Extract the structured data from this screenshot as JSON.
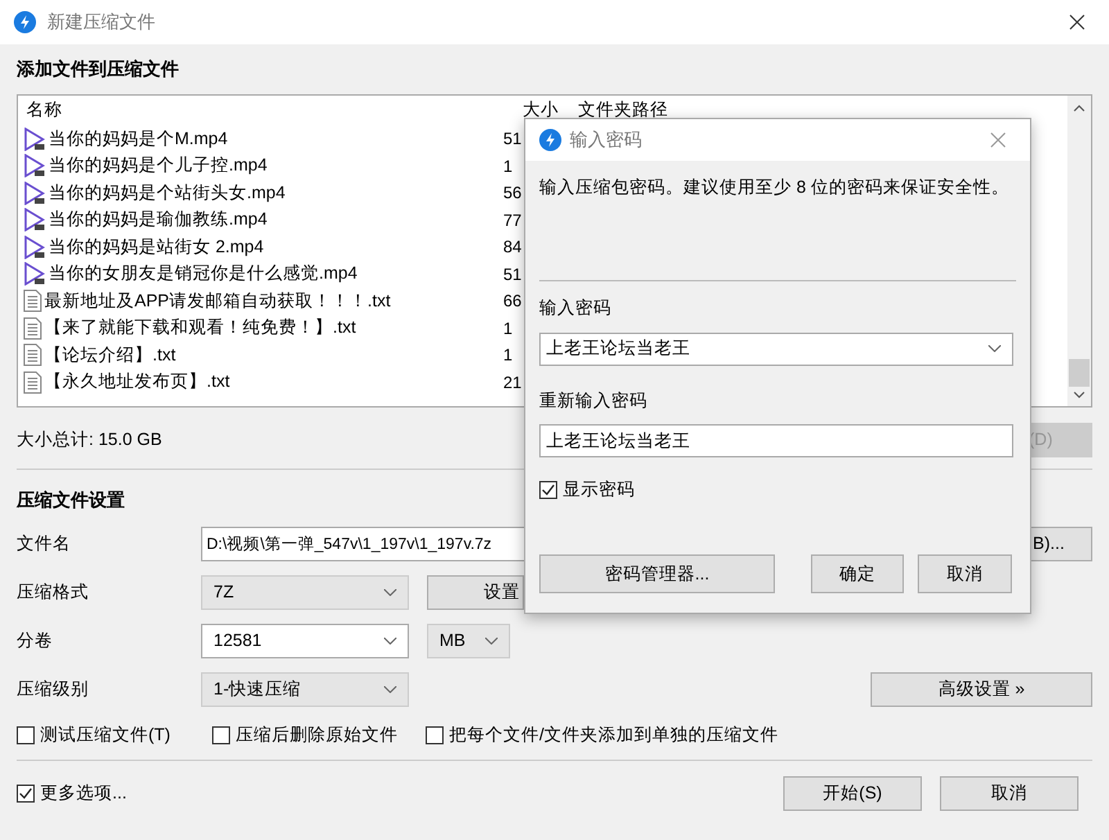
{
  "window": {
    "title": "新建压缩文件"
  },
  "add_section": {
    "title": "添加文件到压缩文件"
  },
  "file_list": {
    "columns": [
      "名称",
      "大小",
      "文件夹路径"
    ],
    "rows": [
      {
        "kind": "video",
        "name": "当你的妈妈是个M.mp4",
        "size": "51"
      },
      {
        "kind": "video",
        "name": "当你的妈妈是个儿子控.mp4",
        "size": "1"
      },
      {
        "kind": "video",
        "name": "当你的妈妈是个站街头女.mp4",
        "size": "56"
      },
      {
        "kind": "video",
        "name": "当你的妈妈是瑜伽教练.mp4",
        "size": "77"
      },
      {
        "kind": "video",
        "name": "当你的妈妈是站街女 2.mp4",
        "size": "84"
      },
      {
        "kind": "video",
        "name": "当你的女朋友是销冠你是什么感觉.mp4",
        "size": "51"
      },
      {
        "kind": "text",
        "name": "最新地址及APP请发邮箱自动获取！！！.txt",
        "size": "66"
      },
      {
        "kind": "text",
        "name": "【来了就能下载和观看！纯免费！】.txt",
        "size": "1"
      },
      {
        "kind": "text",
        "name": "【论坛介绍】.txt",
        "size": "1"
      },
      {
        "kind": "text",
        "name": "【永久地址发布页】.txt",
        "size": "21"
      }
    ]
  },
  "total": "大小总计: 15.0 GB",
  "delete_button": {
    "label": "(D)",
    "disabled": true
  },
  "settings_section": {
    "title": "压缩文件设置"
  },
  "filename": {
    "label": "文件名",
    "value": "D:\\视频\\第一弹_547v\\1_197v\\1_197v.7z",
    "browse_button": "B)..."
  },
  "format": {
    "label": "压缩格式",
    "value": "7Z",
    "settings_button": "设置"
  },
  "split": {
    "label": "分卷",
    "value": "12581",
    "unit": "MB"
  },
  "level": {
    "label": "压缩级别",
    "value": "1-快速压缩",
    "advanced_button": "高级设置 »"
  },
  "options": [
    {
      "label": "测试压缩文件(T)",
      "checked": false
    },
    {
      "label": "压缩后删除原始文件",
      "checked": false
    },
    {
      "label": "把每个文件/文件夹添加到单独的压缩文件",
      "checked": false
    }
  ],
  "more_options": {
    "label": "更多选项...",
    "checked": true
  },
  "buttons": [
    "开始(S)",
    "取消"
  ],
  "password_dialog": {
    "title": "输入密码",
    "message": "输入压缩包密码。建议使用至少 8 位的密码来保证安全性。",
    "password_label": "输入密码",
    "password": "上老王论坛当老王",
    "confirm_label": "重新输入密码",
    "confirm": "上老王论坛当老王",
    "show_password": {
      "label": "显示密码",
      "checked": true
    },
    "buttons": [
      "密码管理器...",
      "确定",
      "取消"
    ]
  }
}
